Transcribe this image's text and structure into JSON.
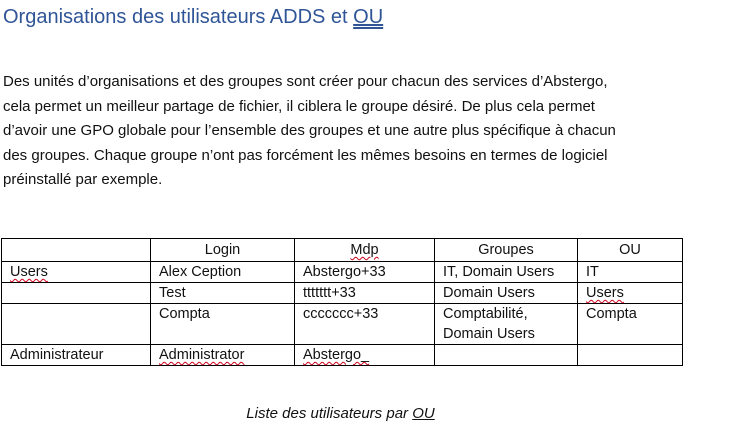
{
  "heading": {
    "text": "Organisations des utilisateurs ADDS et ",
    "ou": "OU"
  },
  "paragraph": {
    "lines": [
      "Des unités d’organisations et des groupes sont créer pour chacun des services d’Abstergo,",
      "cela permet un meilleur partage de fichier, il ciblera le groupe désiré. De plus cela permet",
      "d’avoir une GPO globale pour l’ensemble des groupes et une autre plus spécifique à chacun",
      "des groupes. Chaque groupe n’ont pas forcément les mêmes besoins en termes de logiciel",
      "préinstallé par exemple."
    ]
  },
  "table": {
    "headers": [
      "",
      "Login",
      "Mdp",
      "Groupes",
      "OU"
    ],
    "rows": [
      [
        "Users",
        "Alex Ception",
        "Abstergo+33",
        "IT, Domain Users",
        "IT"
      ],
      [
        "",
        "Test",
        "ttttttt+33",
        "Domain Users",
        "Users"
      ],
      [
        "",
        "Compta",
        "ccccccc+33",
        "Comptabilité, Domain Users",
        "Compta"
      ],
      [
        "Administrateur",
        "Administrator",
        "Abstergo_",
        "",
        ""
      ]
    ]
  },
  "caption": {
    "text": "Liste des utilisateurs par ",
    "ou": "OU"
  },
  "colors": {
    "heading": "#2f5597",
    "spellcheck": "#d0021b",
    "text": "#111111"
  }
}
